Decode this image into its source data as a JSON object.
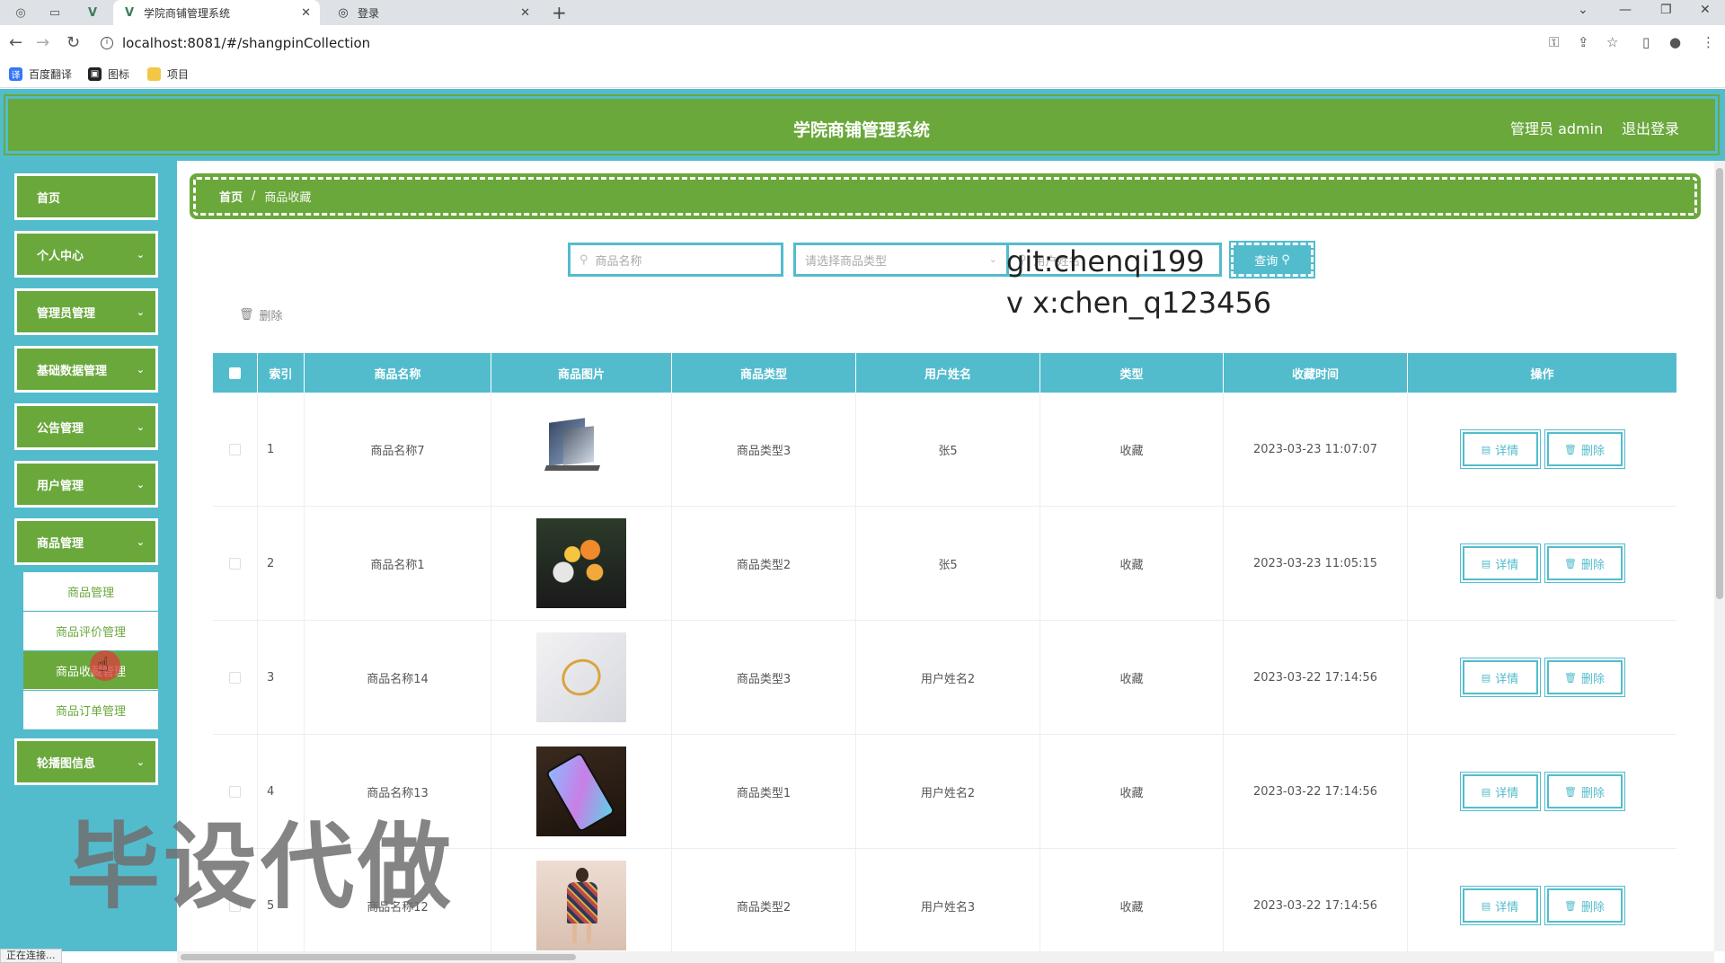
{
  "browser": {
    "tabs": [
      {
        "title": "学院商铺管理系统",
        "active": true
      },
      {
        "title": "登录",
        "active": false
      }
    ],
    "url": "localhost:8081/#/shangpinCollection",
    "bookmarks": [
      "百度翻译",
      "图标",
      "项目"
    ],
    "status_text": "正在连接..."
  },
  "header": {
    "title": "学院商铺管理系统",
    "admin_label": "管理员 admin",
    "logout": "退出登录"
  },
  "sidebar": {
    "items": [
      {
        "label": "首页"
      },
      {
        "label": "个人中心"
      },
      {
        "label": "管理员管理"
      },
      {
        "label": "基础数据管理"
      },
      {
        "label": "公告管理"
      },
      {
        "label": "用户管理"
      },
      {
        "label": "商品管理"
      },
      {
        "label": "轮播图信息"
      }
    ],
    "submenu": [
      {
        "label": "商品管理"
      },
      {
        "label": "商品评价管理"
      },
      {
        "label": "商品收藏管理",
        "active": true
      },
      {
        "label": "商品订单管理"
      }
    ]
  },
  "breadcrumb": {
    "home": "首页",
    "separator": "/",
    "current": "商品收藏"
  },
  "search": {
    "name_placeholder": "商品名称",
    "type_placeholder": "请选择商品类型",
    "user_placeholder": "用户姓名",
    "query_label": "查询"
  },
  "overlay": {
    "git": "git:chenqi199",
    "vx": "v x:chen_q123456",
    "big": "毕设代做"
  },
  "toolbar": {
    "delete_label": "删除"
  },
  "table": {
    "headers": [
      "索引",
      "商品名称",
      "商品图片",
      "商品类型",
      "用户姓名",
      "类型",
      "收藏时间",
      "操作"
    ],
    "detail_label": "详情",
    "delete_label": "删除",
    "rows": [
      {
        "index": "1",
        "name": "商品名称7",
        "image": "laptop",
        "type": "商品类型3",
        "user": "张5",
        "kind": "收藏",
        "time": "2023-03-23 11:07:07"
      },
      {
        "index": "2",
        "name": "商品名称1",
        "image": "flowers",
        "type": "商品类型2",
        "user": "张5",
        "kind": "收藏",
        "time": "2023-03-23 11:05:15"
      },
      {
        "index": "3",
        "name": "商品名称14",
        "image": "ring",
        "type": "商品类型3",
        "user": "用户姓名2",
        "kind": "收藏",
        "time": "2023-03-22 17:14:56"
      },
      {
        "index": "4",
        "name": "商品名称13",
        "image": "phone",
        "type": "商品类型1",
        "user": "用户姓名2",
        "kind": "收藏",
        "time": "2023-03-22 17:14:56"
      },
      {
        "index": "5",
        "name": "商品名称12",
        "image": "dress",
        "type": "商品类型2",
        "user": "用户姓名3",
        "kind": "收藏",
        "time": "2023-03-22 17:14:56"
      }
    ]
  },
  "colors": {
    "primary_green": "#6aa83c",
    "accent_cyan": "#52bccd"
  }
}
